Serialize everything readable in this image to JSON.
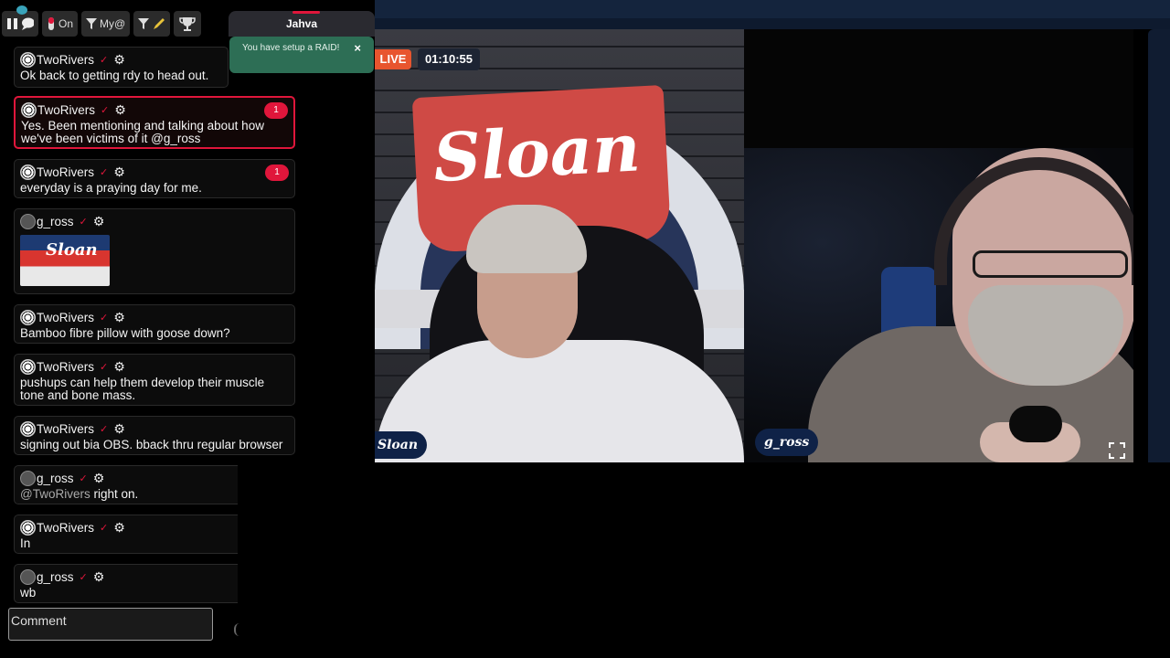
{
  "toolbar": {
    "toggle_label": "On",
    "filter_label": "My@"
  },
  "user_tab": {
    "name": "Jahva"
  },
  "toast": {
    "text": "You have setup a RAID!",
    "close": "×"
  },
  "messages": [
    {
      "user": "TwoRivers",
      "text": "Ok back to getting rdy to head out."
    },
    {
      "user": "TwoRivers",
      "text": "Yes. Been mentioning and talking about how we've been victims of it @g_ross",
      "badge": "1"
    },
    {
      "user": "TwoRivers",
      "text": "everyday is a praying day for me.",
      "badge": "1"
    },
    {
      "user": "g_ross",
      "thumb_text": "Sloan"
    },
    {
      "user": "TwoRivers",
      "text": "Bamboo fibre pillow with goose down?"
    },
    {
      "user": "TwoRivers",
      "text": "pushups can help them develop their muscle tone and bone mass."
    },
    {
      "user": "TwoRivers",
      "text": "signing out bia OBS. bback thru regular browser"
    },
    {
      "user": "g_ross",
      "mention": "@TwoRivers",
      "text": " right on."
    },
    {
      "user": "TwoRivers",
      "text": "In"
    },
    {
      "user": "g_ross",
      "text": "wb"
    }
  ],
  "comment": {
    "placeholder": "Comment"
  },
  "stream": {
    "live_label": "LIVE",
    "timer": "01:10:55",
    "sign_text": "Sloan",
    "host1_name": "Sloan",
    "host2_name": "g_ross"
  },
  "colors": {
    "accent_red": "#e0163b",
    "live_orange": "#e8552e",
    "toast_green": "#2d6e55",
    "nametag_navy": "#0f2247"
  }
}
